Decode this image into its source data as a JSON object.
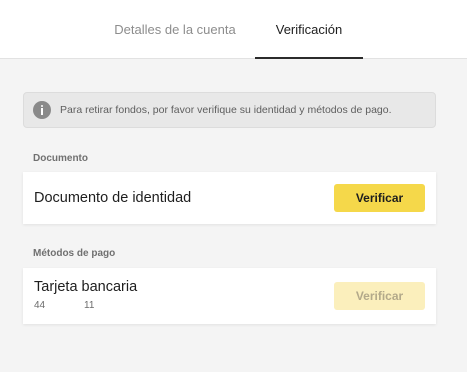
{
  "tabs": [
    {
      "label": "Detalles de la cuenta",
      "active": false
    },
    {
      "label": "Verificación",
      "active": true
    }
  ],
  "notice": {
    "icon": "info-icon",
    "text": "Para retirar fondos, por favor verifique su identidad y métodos de pago."
  },
  "sections": {
    "document": {
      "label": "Documento",
      "item": {
        "title": "Documento de identidad",
        "button_label": "Verificar",
        "button_enabled": true
      }
    },
    "payment": {
      "label": "Métodos de pago",
      "item": {
        "title": "Tarjeta bancaria",
        "subtitle": "44              11",
        "button_label": "Verificar",
        "button_enabled": false
      }
    }
  },
  "colors": {
    "accent": "#f5d84a",
    "accent_disabled": "#fbefbc",
    "background": "#f4f4f4"
  }
}
